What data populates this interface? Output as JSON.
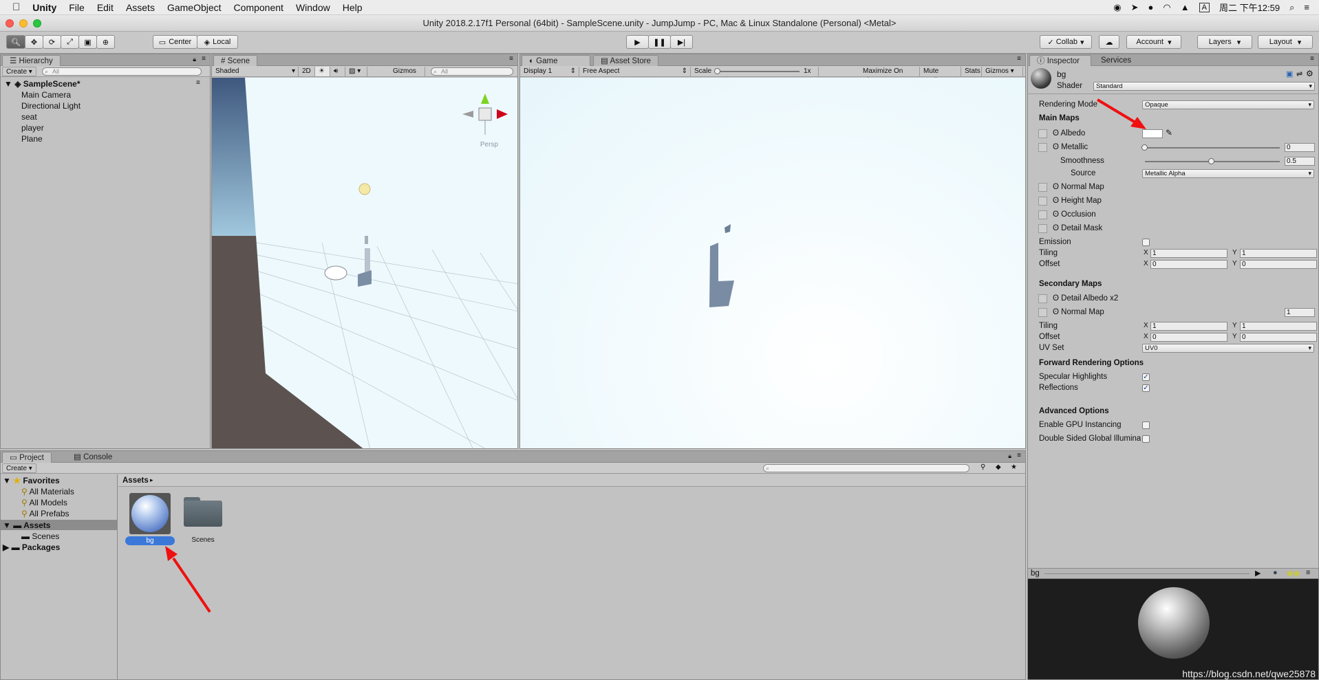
{
  "menubar": {
    "app": "Unity",
    "items": [
      "File",
      "Edit",
      "Assets",
      "GameObject",
      "Component",
      "Window",
      "Help"
    ],
    "clock": "周二 下午12:59"
  },
  "window": {
    "title": "Unity 2018.2.17f1 Personal (64bit) - SampleScene.unity - JumpJump - PC, Mac & Linux Standalone (Personal) <Metal>"
  },
  "toolbar": {
    "pivot": "Center",
    "space": "Local",
    "collab": "Collab",
    "account": "Account",
    "layers": "Layers",
    "layout": "Layout"
  },
  "hierarchy": {
    "tab": "Hierarchy",
    "create": "Create",
    "search_placeholder": "All",
    "scene": "SampleScene*",
    "objects": [
      "Main Camera",
      "Directional Light",
      "seat",
      "player",
      "Plane"
    ]
  },
  "scene_view": {
    "tab": "Scene",
    "shading": "Shaded",
    "mode2d": "2D",
    "gizmos": "Gizmos",
    "search_placeholder": "All",
    "persp": "Persp"
  },
  "game_view": {
    "tab": "Game",
    "tab2": "Asset Store",
    "display": "Display 1",
    "aspect": "Free Aspect",
    "scale_label": "Scale",
    "scale_value": "1x",
    "maximize": "Maximize On Play",
    "mute": "Mute Audio",
    "stats": "Stats",
    "gizmos": "Gizmos"
  },
  "project": {
    "tab": "Project",
    "tab2": "Console",
    "create": "Create",
    "favorites": "Favorites",
    "fav_items": [
      "All Materials",
      "All Models",
      "All Prefabs"
    ],
    "assets": "Assets",
    "scenes": "Scenes",
    "packages": "Packages",
    "breadcrumb": "Assets",
    "grid_items": [
      {
        "name": "bg",
        "kind": "material"
      },
      {
        "name": "Scenes",
        "kind": "folder"
      }
    ]
  },
  "inspector": {
    "tab": "Inspector",
    "tab2": "Services",
    "object_name": "bg",
    "shader_label": "Shader",
    "shader": "Standard",
    "rendering_mode_label": "Rendering Mode",
    "rendering_mode": "Opaque",
    "main_maps": "Main Maps",
    "albedo": "Albedo",
    "metallic": "Metallic",
    "metallic_value": "0",
    "smoothness": "Smoothness",
    "smoothness_value": "0.5",
    "source_label": "Source",
    "source": "Metallic Alpha",
    "normal_map": "Normal Map",
    "height_map": "Height Map",
    "occlusion": "Occlusion",
    "detail_mask": "Detail Mask",
    "emission": "Emission",
    "tiling": "Tiling",
    "offset": "Offset",
    "x": "X",
    "y": "Y",
    "tiling_x": "1",
    "tiling_y": "1",
    "offset_x": "0",
    "offset_y": "0",
    "secondary_maps": "Secondary Maps",
    "detail_albedo": "Detail Albedo x2",
    "normal_map2": "Normal Map",
    "normal_scale": "1",
    "tiling2_x": "1",
    "tiling2_y": "1",
    "offset2_x": "0",
    "offset2_y": "0",
    "uv_set_label": "UV Set",
    "uv_set": "UV0",
    "forward_options": "Forward Rendering Options",
    "specular": "Specular Highlights",
    "reflections": "Reflections",
    "advanced": "Advanced Options",
    "gpu_instancing": "Enable GPU Instancing",
    "double_sided": "Double Sided Global Illumina",
    "preview_name": "bg",
    "watermark": "https://blog.csdn.net/qwe25878"
  },
  "colors": {
    "annotation_arrow": "#f01010",
    "selection": "#3b78d8"
  }
}
